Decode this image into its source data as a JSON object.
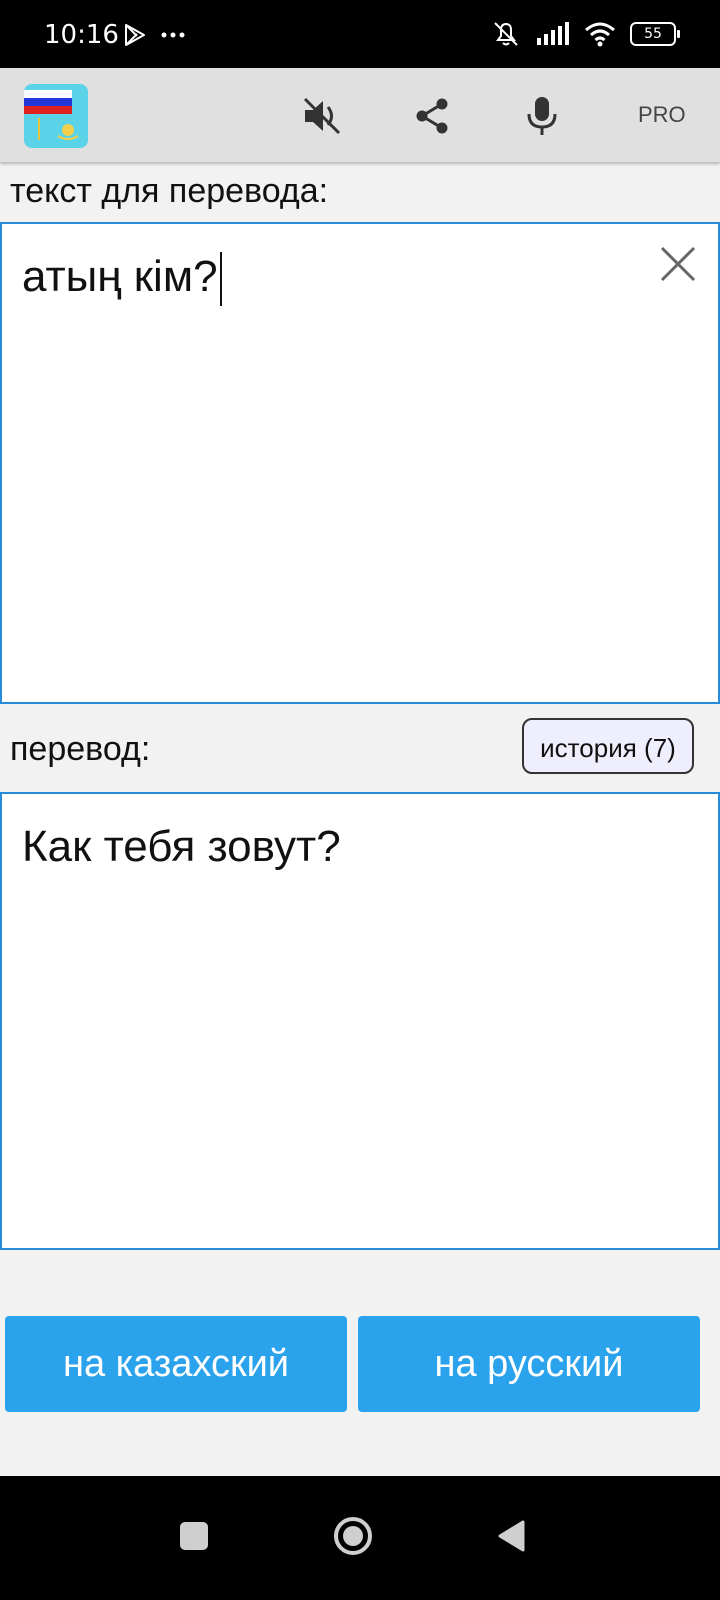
{
  "status_bar": {
    "time": "10:16",
    "battery": "55",
    "icons": [
      "play-store-icon",
      "more-dots-icon",
      "mute-notifications-icon",
      "signal-icon",
      "wifi-icon",
      "battery-icon"
    ]
  },
  "app_bar": {
    "logo": "russian-kazakh-flags-logo",
    "sound_icon": "volume-off-icon",
    "share_icon": "share-icon",
    "mic_icon": "microphone-icon",
    "pro_label": "PRO"
  },
  "input": {
    "label": "текст для перевода:",
    "value": "атың кім?",
    "clear_icon": "close-icon"
  },
  "output": {
    "label": "перевод:",
    "history_label": "история (7)",
    "value": "Как тебя зовут?"
  },
  "actions": {
    "to_kazakh": "на казахский",
    "to_russian": "на русский"
  },
  "colors": {
    "accent": "#2aa2ec",
    "border": "#2a8bd8",
    "app_bar": "#e0e0e0"
  },
  "nav_bar": {
    "icons": [
      "recents-square-icon",
      "home-circle-icon",
      "back-triangle-icon"
    ]
  }
}
